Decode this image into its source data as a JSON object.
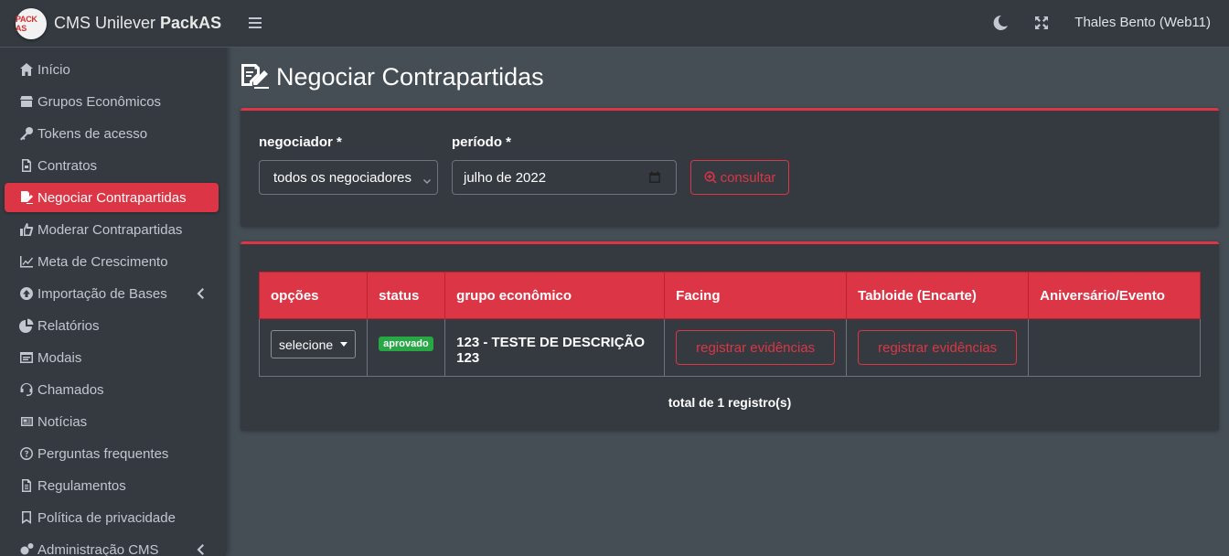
{
  "brand": {
    "logo_text": "PACK AS",
    "name_prefix": "CMS Unilever ",
    "name_bold": "PackAS"
  },
  "topbar": {
    "user": "Thales Bento (Web11)"
  },
  "sidebar": {
    "items": [
      {
        "label": "Início",
        "icon": "home-icon"
      },
      {
        "label": "Grupos Econômicos",
        "icon": "store-icon"
      },
      {
        "label": "Tokens de acesso",
        "icon": "key-icon"
      },
      {
        "label": "Contratos",
        "icon": "file-pdf-icon"
      },
      {
        "label": "Negociar Contrapartidas",
        "icon": "file-signature-icon"
      },
      {
        "label": "Moderar Contrapartidas",
        "icon": "thumbs-up-icon"
      },
      {
        "label": "Meta de Crescimento",
        "icon": "chart-line-icon"
      },
      {
        "label": "Importação de Bases",
        "icon": "upload-circle-icon"
      },
      {
        "label": "Relatórios",
        "icon": "chart-pie-icon"
      },
      {
        "label": "Modais",
        "icon": "window-icon"
      },
      {
        "label": "Chamados",
        "icon": "headset-icon"
      },
      {
        "label": "Notícias",
        "icon": "newspaper-icon"
      },
      {
        "label": "Perguntas frequentes",
        "icon": "question-circle-icon"
      },
      {
        "label": "Regulamentos",
        "icon": "file-alt-icon"
      },
      {
        "label": "Política de privacidade",
        "icon": "bookmark-icon"
      },
      {
        "label": "Administração CMS",
        "icon": "cogs-icon"
      }
    ],
    "active_index": 4
  },
  "main": {
    "title": "Negociar Contrapartidas",
    "filters": {
      "negociador_label": "negociador *",
      "negociador_value": "todos os negociadores",
      "periodo_label": "período *",
      "periodo_value": "julho de 2022",
      "consultar_label": "consultar"
    },
    "table": {
      "headers": [
        "opções",
        "status",
        "grupo econômico",
        "Facing",
        "Tabloide (Encarte)",
        "Aniversário/Evento"
      ],
      "rows": [
        {
          "opcoes": "selecione",
          "status": "aprovado",
          "grupo": "123 - TESTE DE DESCRIÇÃO 123",
          "facing": "registrar evidências",
          "tabloide": "registrar evidências",
          "aniversario": ""
        }
      ],
      "total": "total de 1 registro(s)"
    }
  },
  "colors": {
    "accent": "#dc3545",
    "success": "#28a745",
    "sidebar_bg": "#343a40",
    "content_bg": "#454d55"
  }
}
